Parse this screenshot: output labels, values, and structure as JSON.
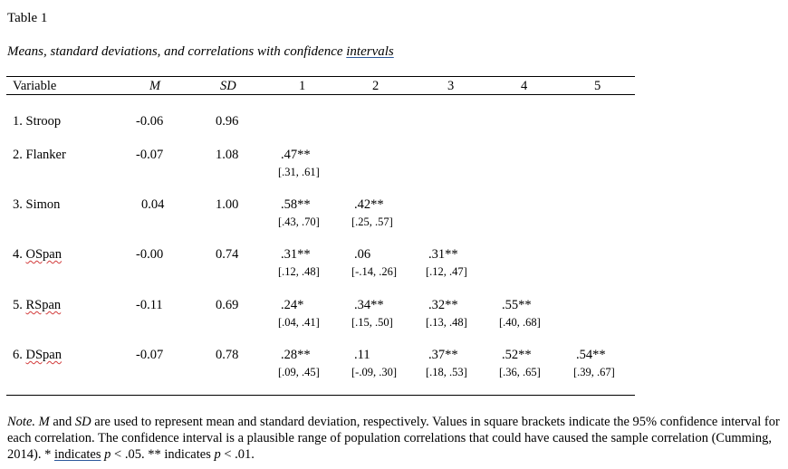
{
  "table_label": "Table 1",
  "table_title_main": "Means, standard deviations, and correlations with confidence ",
  "table_title_flagged": "intervals",
  "headers": {
    "variable": "Variable",
    "mean": "M",
    "sd": "SD",
    "c1": "1",
    "c2": "2",
    "c3": "3",
    "c4": "4",
    "c5": "5"
  },
  "rows": [
    {
      "num": "1. ",
      "name": "Stroop",
      "m": "-0.06",
      "sd": "0.96",
      "corr": []
    },
    {
      "num": "2. ",
      "name": "Flanker",
      "m": "-0.07",
      "sd": "1.08",
      "corr": [
        {
          "r": ".47**",
          "ci": "[.31, .61]"
        }
      ]
    },
    {
      "num": "3. ",
      "name": "Simon",
      "m": "0.04",
      "sd": "1.00",
      "corr": [
        {
          "r": ".58**",
          "ci": "[.43, .70]"
        },
        {
          "r": ".42**",
          "ci": "[.25, .57]"
        }
      ]
    },
    {
      "num": "4. ",
      "name": "OSpan",
      "m": "-0.00",
      "sd": "0.74",
      "corr": [
        {
          "r": ".31**",
          "ci": "[.12, .48]"
        },
        {
          "r": ".06",
          "ci": "[-.14, .26]"
        },
        {
          "r": ".31**",
          "ci": "[.12, .47]"
        }
      ]
    },
    {
      "num": "5. ",
      "name": "RSpan",
      "m": "-0.11",
      "sd": "0.69",
      "corr": [
        {
          "r": ".24*",
          "ci": "[.04, .41]"
        },
        {
          "r": ".34**",
          "ci": "[.15, .50]"
        },
        {
          "r": ".32**",
          "ci": "[.13, .48]"
        },
        {
          "r": ".55**",
          "ci": "[.40, .68]"
        }
      ]
    },
    {
      "num": "6. ",
      "name": "DSpan",
      "m": "-0.07",
      "sd": "0.78",
      "corr": [
        {
          "r": ".28**",
          "ci": "[.09, .45]"
        },
        {
          "r": ".11",
          "ci": "[-.09, .30]"
        },
        {
          "r": ".37**",
          "ci": "[.18, .53]"
        },
        {
          "r": ".52**",
          "ci": "[.36, .65]"
        },
        {
          "r": ".54**",
          "ci": "[.39, .67]"
        }
      ]
    }
  ],
  "note": {
    "label": "Note.",
    "m": "M",
    "t1": " and ",
    "sd": "SD",
    "t2": " are used to represent mean and standard deviation, respectively. Values in square brackets indicate the 95% confidence interval for each correlation. The confidence interval is a plausible range of population correlations that could have caused the sample correlation (Cumming, 2014). * ",
    "indicates": "indicates",
    "p1": "p",
    "t3": " < .05. ** indicates ",
    "p2": "p",
    "t4": " < .01."
  },
  "colors": {
    "grammar_underline": "#2b579a",
    "spelling_underline": "#d23b3b"
  }
}
